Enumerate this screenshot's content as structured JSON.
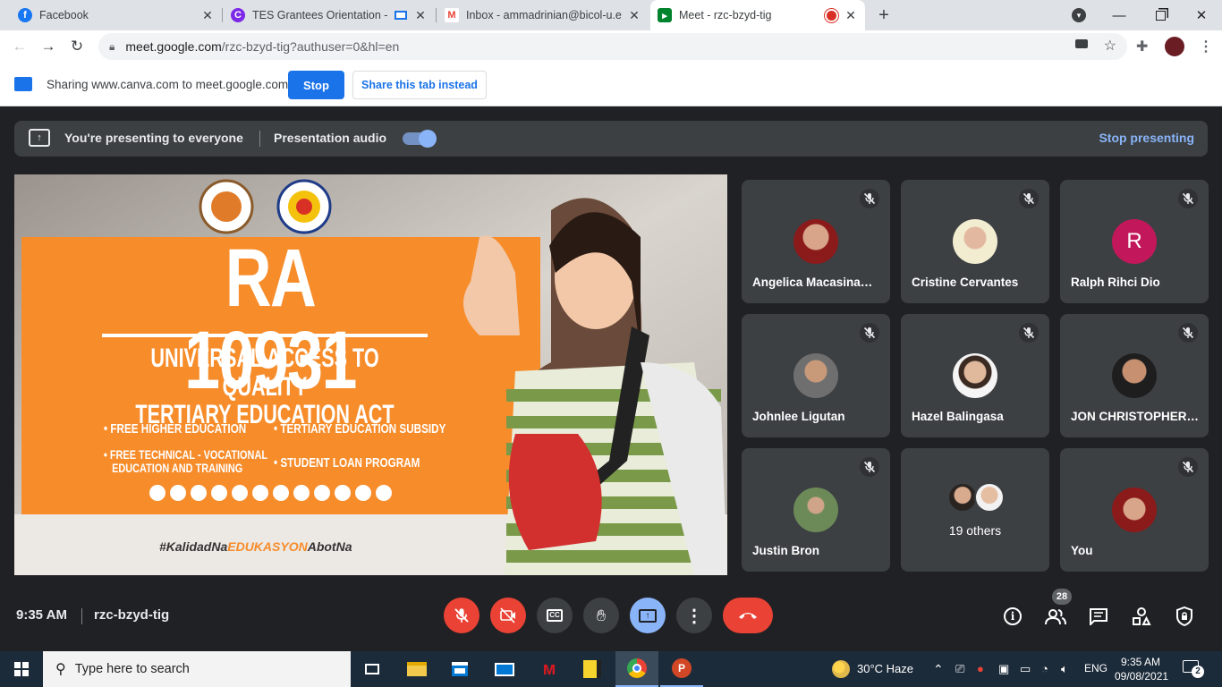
{
  "browser": {
    "tabs": [
      {
        "title": "Facebook"
      },
      {
        "title": "TES Grantees Orientation - P"
      },
      {
        "title": "Inbox - ammadrinian@bicol-u.ed"
      },
      {
        "title": "Meet - rzc-bzyd-tig"
      }
    ],
    "address": {
      "host": "meet.google.com",
      "path": "/rzc-bzyd-tig?authuser=0&hl=en"
    }
  },
  "sharing_bar": {
    "text": "Sharing www.canva.com to meet.google.com",
    "stop": "Stop",
    "share_tab": "Share this tab instead"
  },
  "presenting_bar": {
    "status": "You're presenting to everyone",
    "audio_label": "Presentation audio",
    "audio_on": true,
    "stop_presenting": "Stop presenting"
  },
  "slide": {
    "title": "RA 10931",
    "subtitle_line1": "UNIVERSAL ACCESS TO QUALITY",
    "subtitle_line2": "TERTIARY EDUCATION ACT",
    "bullets": [
      "FREE HIGHER EDUCATION",
      "TERTIARY EDUCATION SUBSIDY",
      "FREE TECHNICAL - VOCATIONAL",
      "EDUCATION AND TRAINING",
      "STUDENT LOAN PROGRAM"
    ],
    "hashtag_a": "#KalidadNa",
    "hashtag_b": "EDUKASYON",
    "hashtag_c": "AbotNa"
  },
  "participants": [
    {
      "name": "Angelica Macasina…"
    },
    {
      "name": "Cristine Cervantes"
    },
    {
      "name": "Ralph Rihci Dio",
      "initial": "R"
    },
    {
      "name": "Johnlee Ligutan"
    },
    {
      "name": "Hazel Balingasa"
    },
    {
      "name": "JON CHRISTOPHER…"
    },
    {
      "name": "Justin Bron"
    },
    {
      "name": "19 others"
    },
    {
      "name": "You"
    }
  ],
  "meeting": {
    "time": "9:35 AM",
    "code": "rzc-bzyd-tig",
    "participant_count": "28"
  },
  "taskbar": {
    "search_placeholder": "Type here to search",
    "weather": "30°C  Haze",
    "lang": "ENG",
    "time": "9:35 AM",
    "date": "09/08/2021",
    "notifications": "2"
  },
  "colors": {
    "accent": "#1a73e8",
    "end_call": "#ea4335",
    "meet_bg": "#202124",
    "tile": "#3c4043",
    "slide_orange": "#f78c2a"
  }
}
